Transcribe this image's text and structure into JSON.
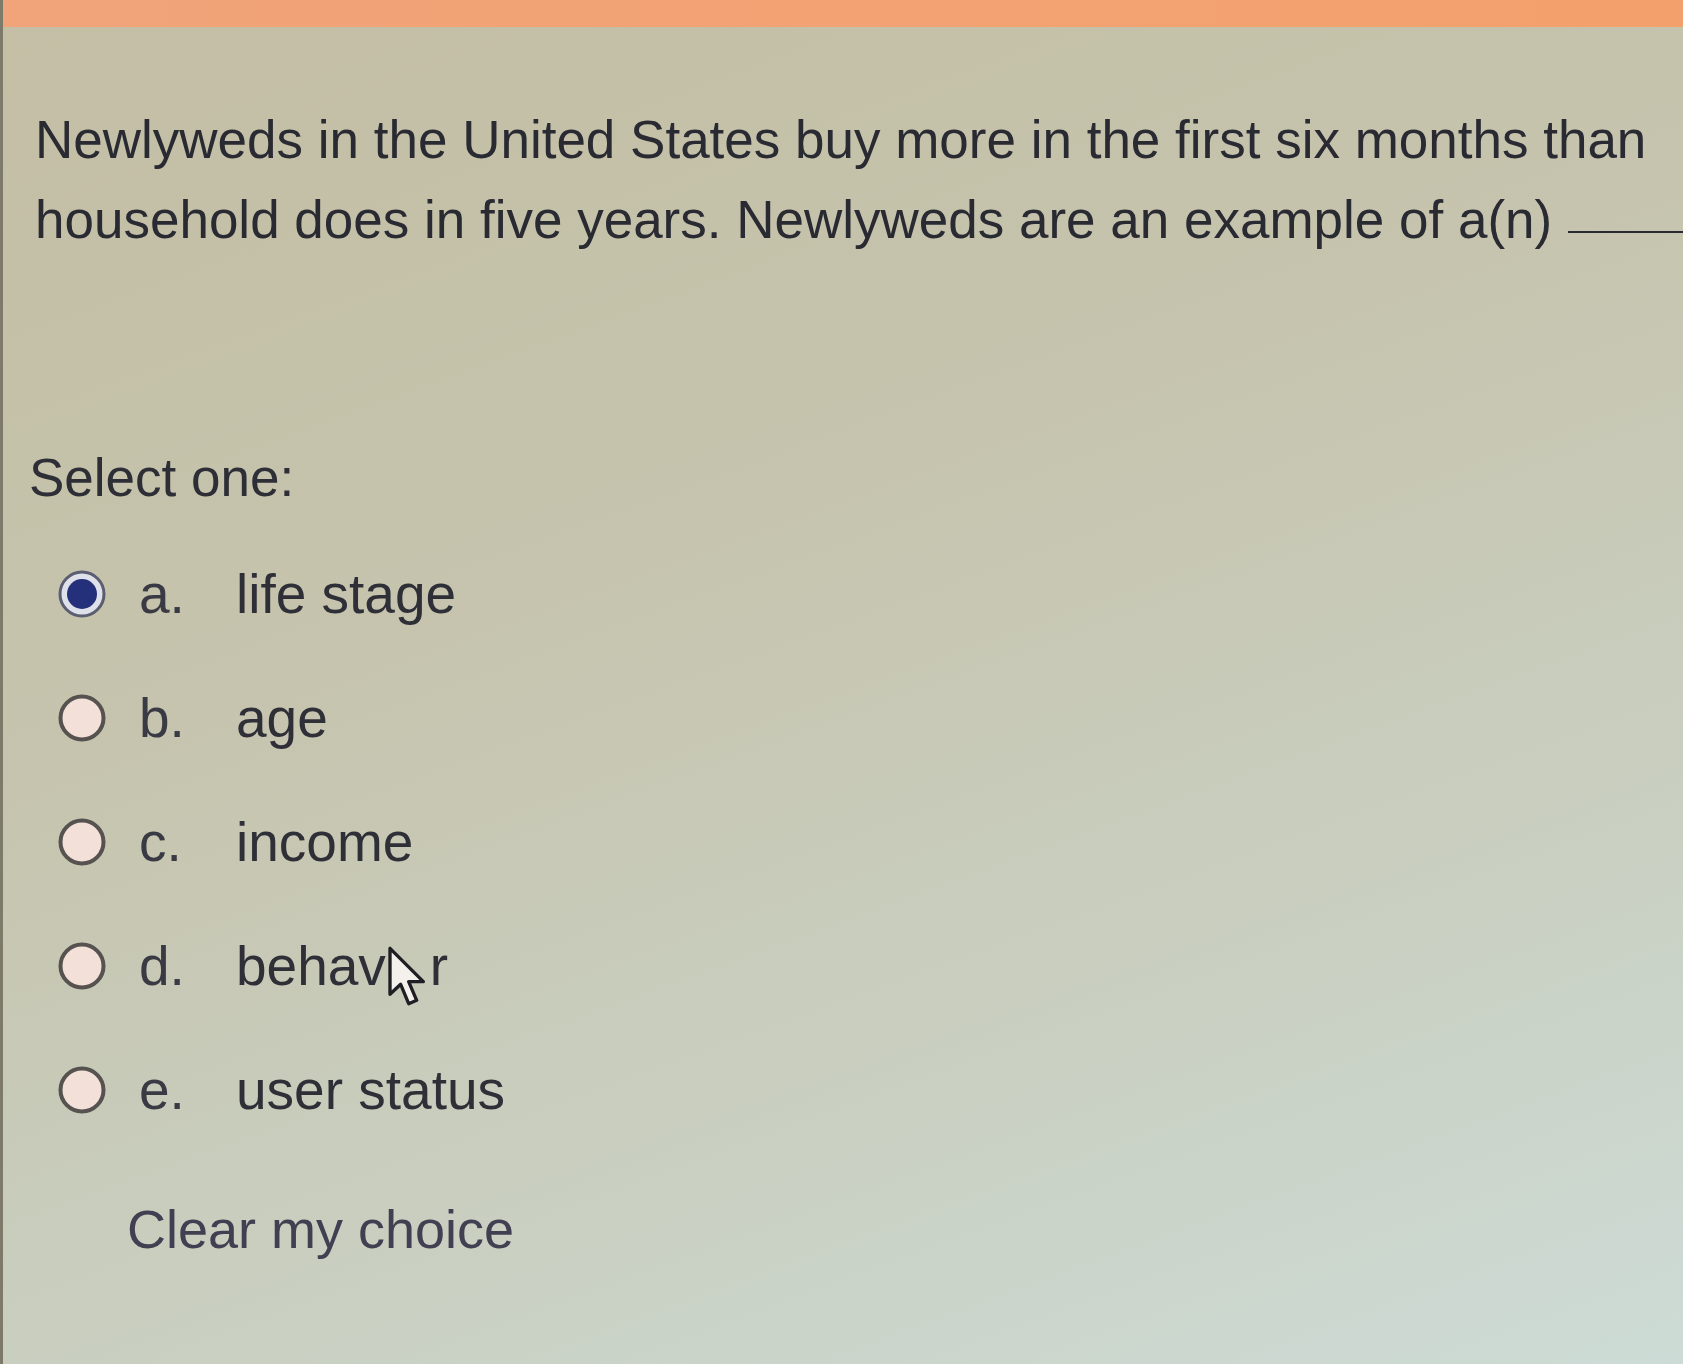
{
  "question": {
    "lines": [
      "Newlyweds in the United States buy more in the first six months than",
      "household does in five years. Newlyweds are an example of a(n)"
    ]
  },
  "prompt": "Select one:",
  "options": [
    {
      "letter": "a.",
      "text": "life stage",
      "selected": true
    },
    {
      "letter": "b.",
      "text": "age",
      "selected": false
    },
    {
      "letter": "c.",
      "text": "income",
      "selected": false
    },
    {
      "letter": "d.",
      "text": "behav",
      "text_after_pointer": "r",
      "selected": false
    },
    {
      "letter": "e.",
      "text": "user status",
      "selected": false
    }
  ],
  "clear_link": "Clear my choice"
}
